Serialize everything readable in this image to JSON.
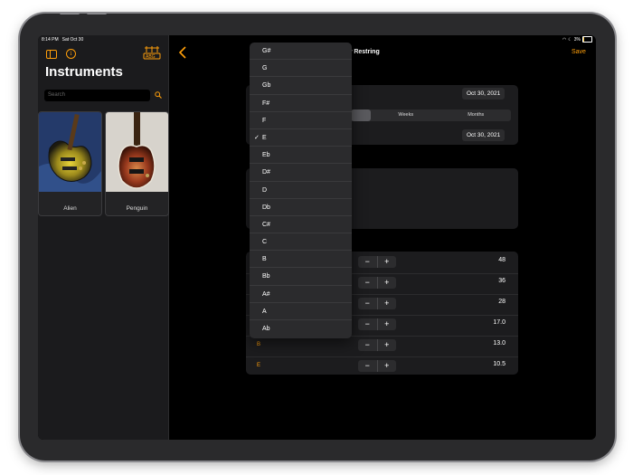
{
  "status_bar": {
    "time": "8:14 PM",
    "date": "Sat Oct 30",
    "battery": "3%"
  },
  "sidebar": {
    "title": "Instruments",
    "search_placeholder": "Search",
    "instruments": [
      {
        "name": "Alien"
      },
      {
        "name": "Penguin"
      }
    ]
  },
  "navbar": {
    "title": "New Restring",
    "save_label": "Save"
  },
  "form": {
    "date_1": "Oct 30, 2021",
    "date_2": "Oct 30, 2021",
    "segments": [
      "",
      "Weeks",
      "Months"
    ],
    "strings": [
      {
        "note": "",
        "gauge": "48"
      },
      {
        "note": "",
        "gauge": "36"
      },
      {
        "note": "",
        "gauge": "28"
      },
      {
        "note": "",
        "gauge": "17.0"
      },
      {
        "note": "B",
        "gauge": "13.0"
      },
      {
        "note": "E",
        "gauge": "10.5"
      }
    ]
  },
  "dropdown": {
    "selected": "E",
    "options": [
      "G#",
      "G",
      "Gb",
      "F#",
      "F",
      "E",
      "Eb",
      "D#",
      "D",
      "Db",
      "C#",
      "C",
      "B",
      "Bb",
      "A#",
      "A",
      "Ab"
    ]
  },
  "colors": {
    "accent": "#ff9f0a",
    "background": "#000000",
    "sidebar": "#1b1b1d"
  }
}
